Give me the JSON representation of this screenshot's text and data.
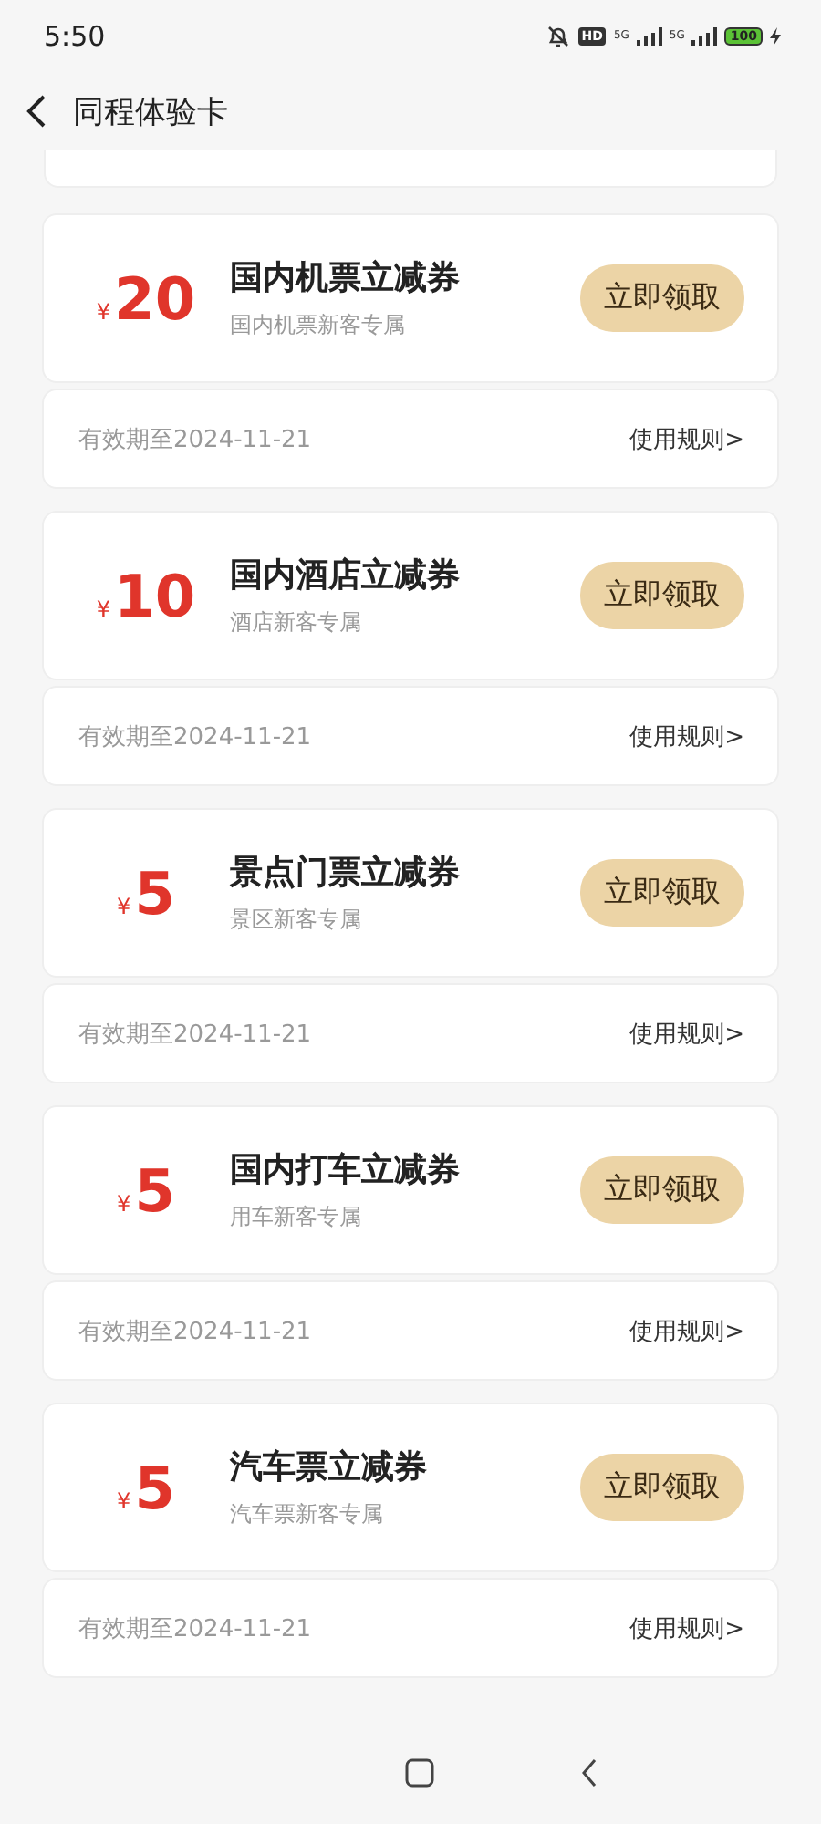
{
  "status_bar": {
    "time": "5:50",
    "hd": "HD",
    "networks": [
      "5G",
      "5G"
    ],
    "battery": "100"
  },
  "header": {
    "title": "同程体验卡"
  },
  "coupons": [
    {
      "currency": "¥",
      "amount": "20",
      "title": "国内机票立减券",
      "subtitle": "国内机票新客专属",
      "button": "立即领取",
      "validity": "有效期至2024-11-21",
      "rules": "使用规则>"
    },
    {
      "currency": "¥",
      "amount": "10",
      "title": "国内酒店立减券",
      "subtitle": "酒店新客专属",
      "button": "立即领取",
      "validity": "有效期至2024-11-21",
      "rules": "使用规则>"
    },
    {
      "currency": "¥",
      "amount": "5",
      "title": "景点门票立减券",
      "subtitle": "景区新客专属",
      "button": "立即领取",
      "validity": "有效期至2024-11-21",
      "rules": "使用规则>"
    },
    {
      "currency": "¥",
      "amount": "5",
      "title": "国内打车立减券",
      "subtitle": "用车新客专属",
      "button": "立即领取",
      "validity": "有效期至2024-11-21",
      "rules": "使用规则>"
    },
    {
      "currency": "¥",
      "amount": "5",
      "title": "汽车票立减券",
      "subtitle": "汽车票新客专属",
      "button": "立即领取",
      "validity": "有效期至2024-11-21",
      "rules": "使用规则>"
    }
  ]
}
